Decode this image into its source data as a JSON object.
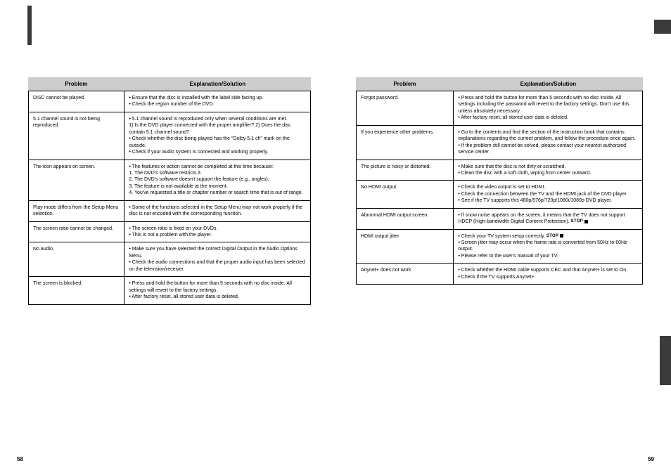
{
  "left_page_number": "58",
  "right_page_number": "59",
  "left_table": {
    "headers": {
      "col_a": "Problem",
      "col_b": "Explanation/Solution"
    },
    "rows": [
      {
        "a": "DISC cannot be played.",
        "b": "• Ensure that the disc is installed with the label side facing up.\n• Check the region number of the DVD."
      },
      {
        "a": "5.1 channel sound is not being reproduced.",
        "b": "• 5.1 channel sound is reproduced only when several conditions are met.\n1) Is the DVD player connected with the proper amplifier? 2) Does the disc contain 5.1 channel sound?\n• Check whether the disc being played has the \"Dolby 5.1 ch\" mark on the outside.\n• Check if your audio system is connected and working properly."
      },
      {
        "a": "The     icon appears on screen.",
        "b": "• The features or action cannot be completed at this time because:\n1. The DVD's software restricts it.\n2. The DVD's software doesn't support the feature (e.g., angles).\n3. The feature is not available at the moment.\n4. You've requested a title or chapter number or search time that is out of range."
      },
      {
        "a": "Play mode differs from the Setup Menu selection.",
        "b": "• Some of the functions selected in the Setup Menu may not work properly if the disc is not encoded with the corresponding function."
      },
      {
        "a": "The screen ratio cannot be changed.",
        "b": "• The screen ratio is fixed on your DVDs.\n• This is not a problem with the player."
      },
      {
        "a": "No audio.",
        "b": "• Make sure you have selected the correct Digital Output in the Audio Options Menu.\n• Check the audio connections and that the proper audio input has been selected on the television/receiver."
      },
      {
        "a": "The screen is blocked.",
        "b": "• Press and hold the button for more than 5 seconds with no disc inside. All settings will revert to the factory settings.\n• After factory reset, all stored user data is deleted."
      }
    ]
  },
  "right_table": {
    "headers": {
      "col_a": "Problem",
      "col_b": "Explanation/Solution"
    },
    "rows": [
      {
        "a": "Forgot password.",
        "b": "• Press and hold the button for more than 5 seconds with no disc inside. All settings including the password will revert to the factory settings. Don't use this unless absolutely necessary.\n• After factory reset, all stored user data is deleted."
      },
      {
        "a": "If you experience other problems.",
        "b": "• Go to the contents and find the section of the instruction book that contains explanations regarding the current problem, and follow the procedure once again.\n• If the problem still cannot be solved, please contact your nearest authorized service center."
      },
      {
        "a": "The picture is noisy or distorted.",
        "b": "• Make sure that the disc is not dirty or scratched.\n• Clean the disc with a soft cloth, wiping from center outward."
      },
      {
        "a": "No HDMI output.",
        "b": "• Check the video output is set to HDMI.\n• Check the connection between the TV and the HDMI jack of the DVD player.\n• See if the TV supports this 480p/576p/720p/1080i/1080p DVD player."
      },
      {
        "a": "Abnormal HDMI output screen.",
        "b": "• If snow noise appears on the screen, it means that the TV does not support HDCP (High-bandwidth Digital Content Protection).",
        "stop": true
      },
      {
        "a": "HDMI output jitter",
        "b": "• Check your TV system setup correctly.\n• Screen jitter may occur when the frame rate is converted from 50Hz to 60Hz output.\n• Please refer to the user's manual of your TV.",
        "stop": true
      },
      {
        "a": "Anynet+ does not work",
        "b": "• Check whether the HDMI cable supports CEC and that Anynet+ is set to On.\n• Check if the TV supports Anynet+."
      }
    ]
  }
}
